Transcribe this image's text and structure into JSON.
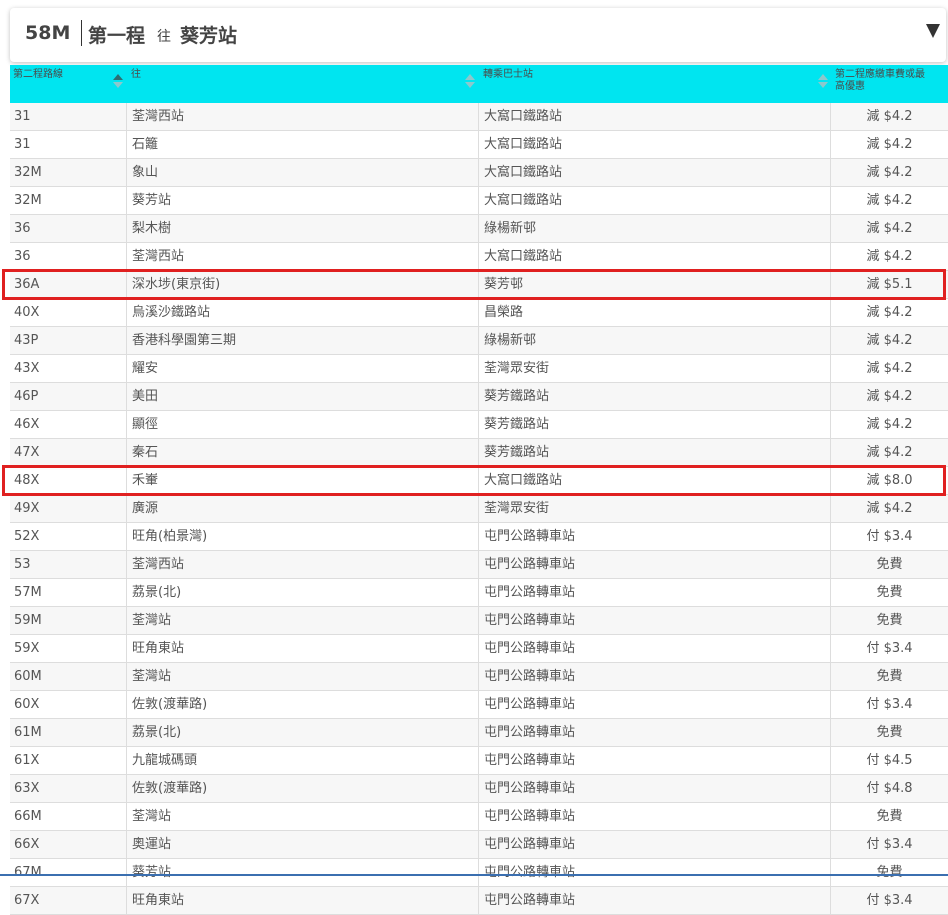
{
  "header": {
    "route": "58M",
    "from": "第一程",
    "to_word": "往",
    "destination": "葵芳站"
  },
  "columns": {
    "route": "第二程路線",
    "dest": "往",
    "interchange": "轉乘巴士站",
    "fare_line1": "第二程應繳車費或最",
    "fare_line2": "高優惠"
  },
  "colors": {
    "header_bg": "#00e5f0",
    "highlight": "#e02020"
  },
  "rows": [
    {
      "route": "31",
      "dest": "荃灣西站",
      "interchange": "大窩口鐵路站",
      "fare": "減 $4.2"
    },
    {
      "route": "31",
      "dest": "石籬",
      "interchange": "大窩口鐵路站",
      "fare": "減 $4.2"
    },
    {
      "route": "32M",
      "dest": "象山",
      "interchange": "大窩口鐵路站",
      "fare": "減 $4.2"
    },
    {
      "route": "32M",
      "dest": "葵芳站",
      "interchange": "大窩口鐵路站",
      "fare": "減 $4.2"
    },
    {
      "route": "36",
      "dest": "梨木樹",
      "interchange": "綠楊新邨",
      "fare": "減 $4.2"
    },
    {
      "route": "36",
      "dest": "荃灣西站",
      "interchange": "大窩口鐵路站",
      "fare": "減 $4.2"
    },
    {
      "route": "36A",
      "dest": "深水埗(東京街)",
      "interchange": "葵芳邨",
      "fare": "減 $5.1"
    },
    {
      "route": "40X",
      "dest": "烏溪沙鐵路站",
      "interchange": "昌榮路",
      "fare": "減 $4.2"
    },
    {
      "route": "43P",
      "dest": "香港科學園第三期",
      "interchange": "綠楊新邨",
      "fare": "減 $4.2"
    },
    {
      "route": "43X",
      "dest": "耀安",
      "interchange": "荃灣眾安街",
      "fare": "減 $4.2"
    },
    {
      "route": "46P",
      "dest": "美田",
      "interchange": "葵芳鐵路站",
      "fare": "減 $4.2"
    },
    {
      "route": "46X",
      "dest": "顯徑",
      "interchange": "葵芳鐵路站",
      "fare": "減 $4.2"
    },
    {
      "route": "47X",
      "dest": "秦石",
      "interchange": "葵芳鐵路站",
      "fare": "減 $4.2"
    },
    {
      "route": "48X",
      "dest": "禾輋",
      "interchange": "大窩口鐵路站",
      "fare": "減 $8.0"
    },
    {
      "route": "49X",
      "dest": "廣源",
      "interchange": "荃灣眾安街",
      "fare": "減 $4.2"
    },
    {
      "route": "52X",
      "dest": "旺角(柏景灣)",
      "interchange": "屯門公路轉車站",
      "fare": "付 $3.4"
    },
    {
      "route": "53",
      "dest": "荃灣西站",
      "interchange": "屯門公路轉車站",
      "fare": "免費"
    },
    {
      "route": "57M",
      "dest": "荔景(北)",
      "interchange": "屯門公路轉車站",
      "fare": "免費"
    },
    {
      "route": "59M",
      "dest": "荃灣站",
      "interchange": "屯門公路轉車站",
      "fare": "免費"
    },
    {
      "route": "59X",
      "dest": "旺角東站",
      "interchange": "屯門公路轉車站",
      "fare": "付 $3.4"
    },
    {
      "route": "60M",
      "dest": "荃灣站",
      "interchange": "屯門公路轉車站",
      "fare": "免費"
    },
    {
      "route": "60X",
      "dest": "佐敦(渡華路)",
      "interchange": "屯門公路轉車站",
      "fare": "付 $3.4"
    },
    {
      "route": "61M",
      "dest": "荔景(北)",
      "interchange": "屯門公路轉車站",
      "fare": "免費"
    },
    {
      "route": "61X",
      "dest": "九龍城碼頭",
      "interchange": "屯門公路轉車站",
      "fare": "付 $4.5"
    },
    {
      "route": "63X",
      "dest": "佐敦(渡華路)",
      "interchange": "屯門公路轉車站",
      "fare": "付 $4.8"
    },
    {
      "route": "66M",
      "dest": "荃灣站",
      "interchange": "屯門公路轉車站",
      "fare": "免費"
    },
    {
      "route": "66X",
      "dest": "奧運站",
      "interchange": "屯門公路轉車站",
      "fare": "付 $3.4"
    },
    {
      "route": "67M",
      "dest": "葵芳站",
      "interchange": "屯門公路轉車站",
      "fare": "免費"
    },
    {
      "route": "67X",
      "dest": "旺角東站",
      "interchange": "屯門公路轉車站",
      "fare": "付 $3.4"
    }
  ],
  "highlighted_rows": [
    6,
    13
  ]
}
